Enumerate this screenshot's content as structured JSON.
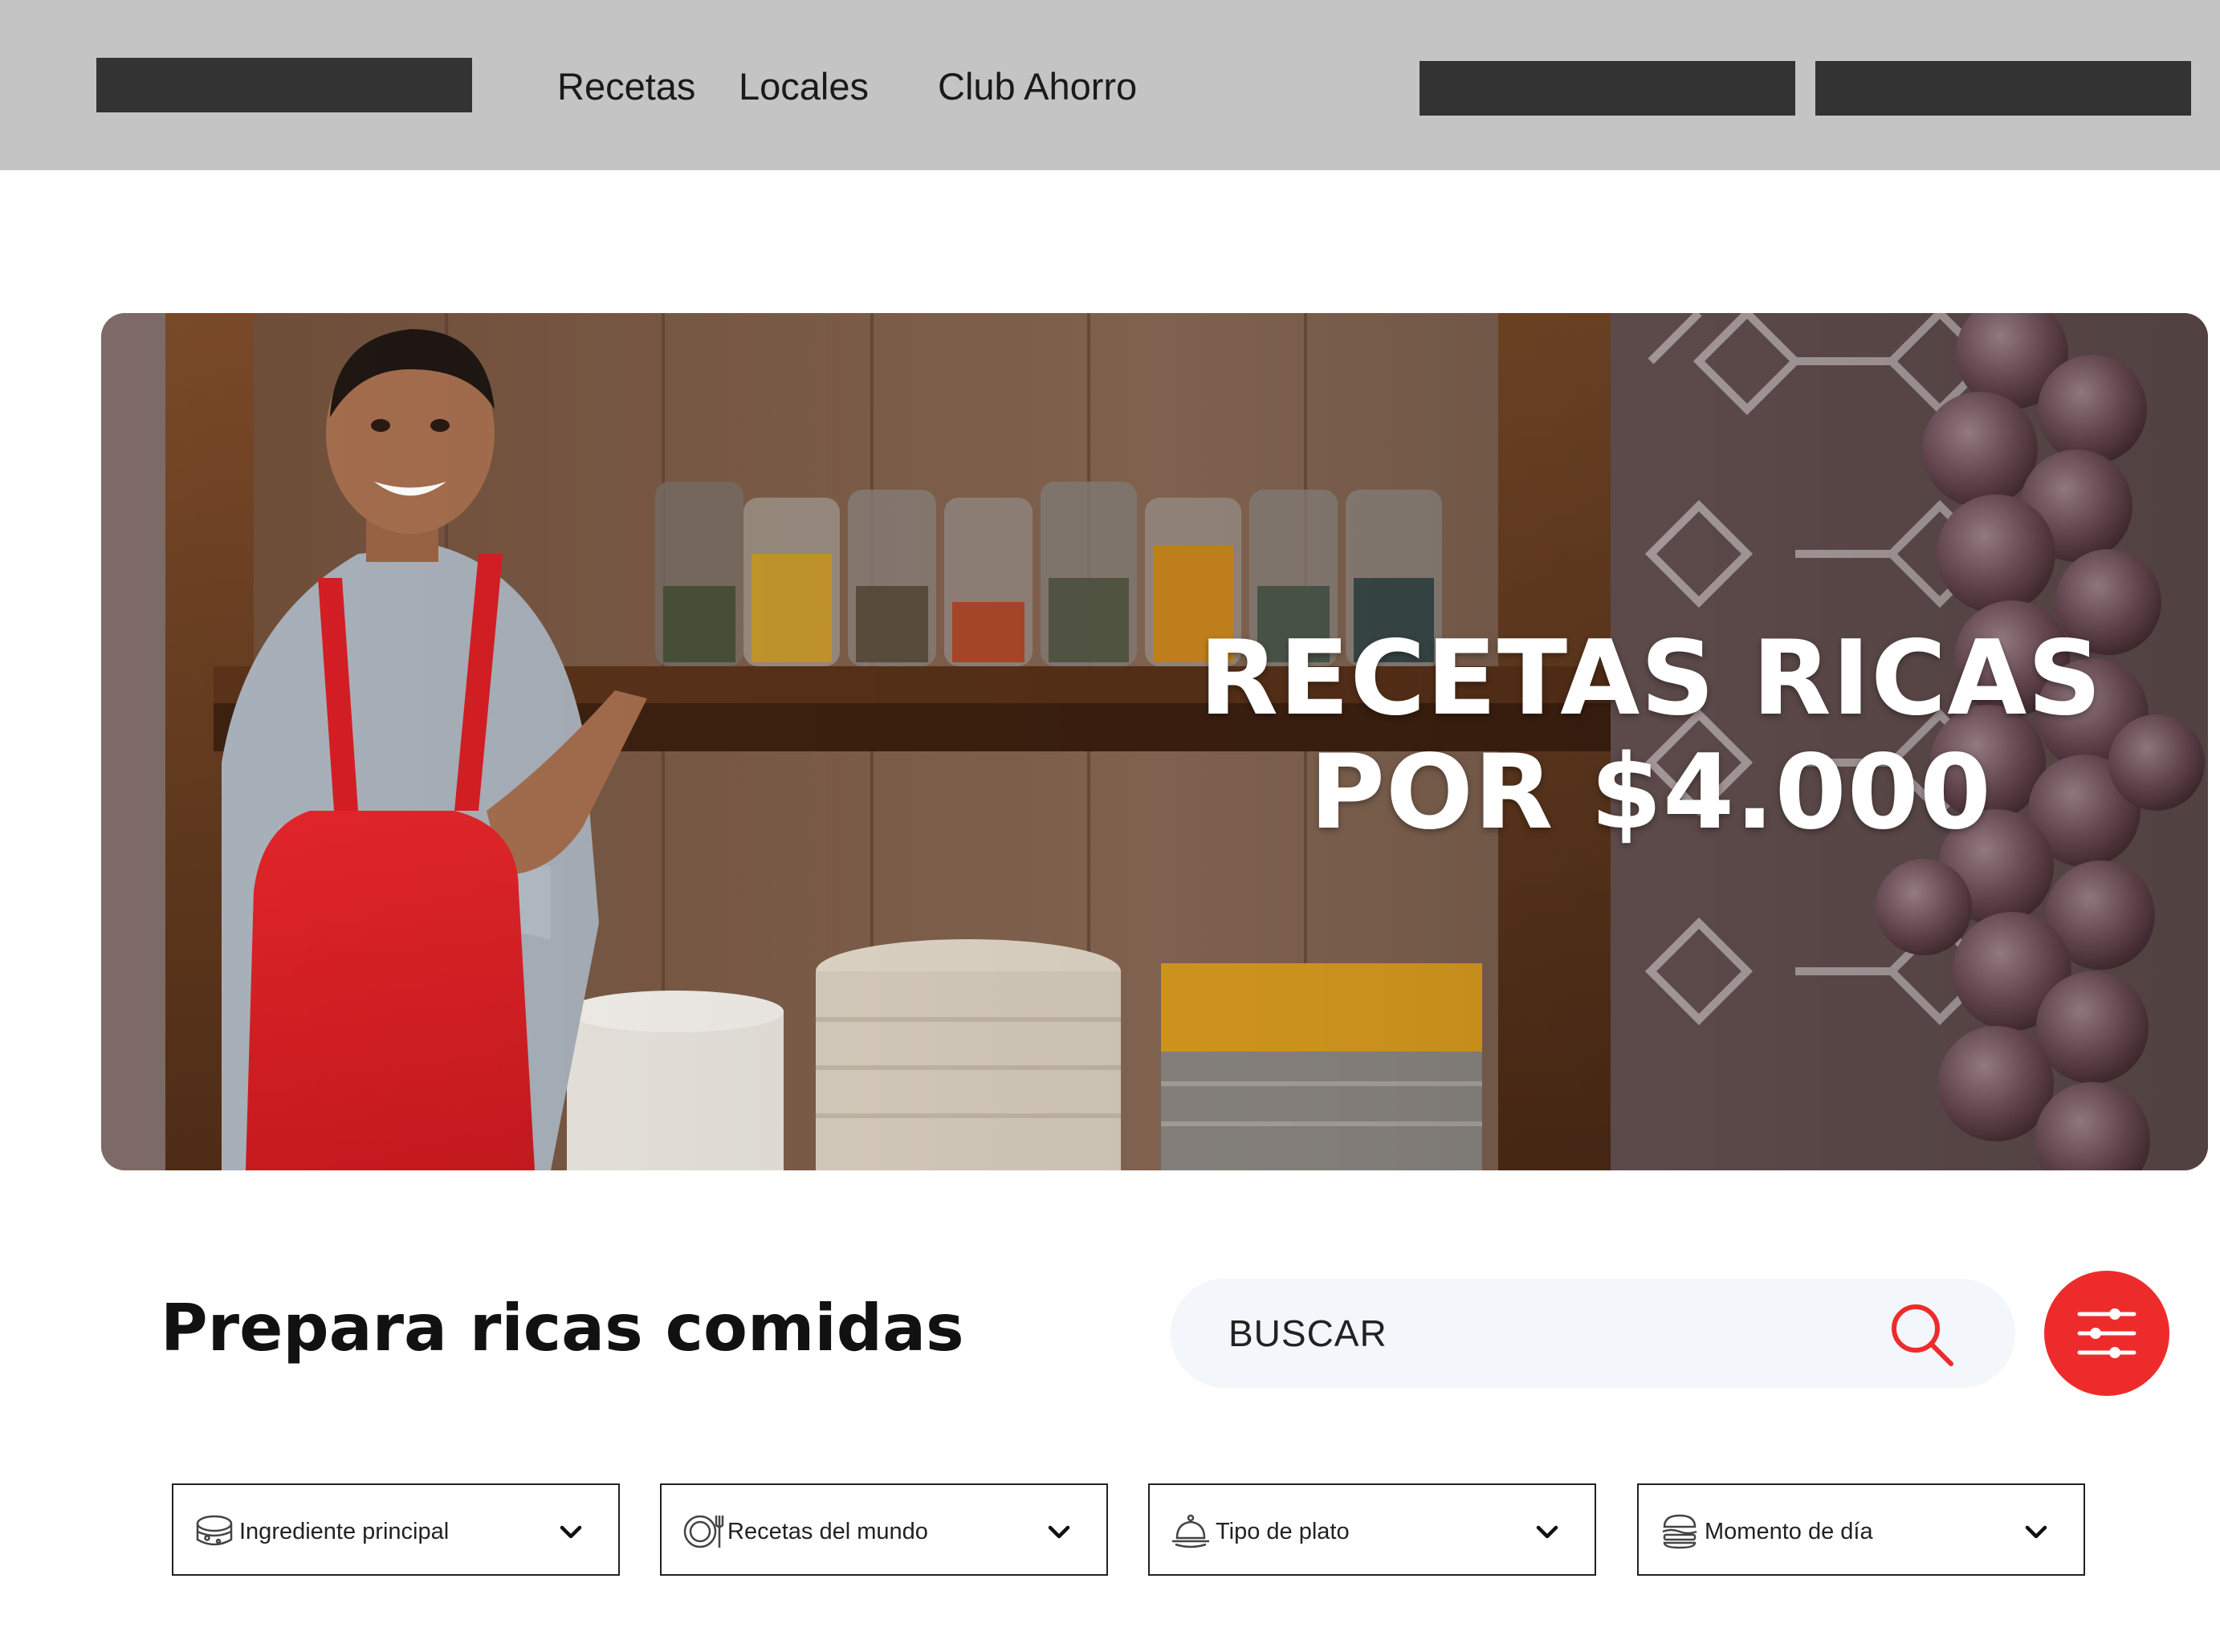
{
  "header": {
    "nav": [
      {
        "label": "Recetas"
      },
      {
        "label": "Locales"
      },
      {
        "label": "Club Ahorro"
      }
    ]
  },
  "hero": {
    "title_line1": "RECETAS RICAS",
    "title_line2": "POR $4.000"
  },
  "section": {
    "title": "Prepara ricas comidas"
  },
  "search": {
    "placeholder": "BUSCAR",
    "accent_color": "#ee2b2b"
  },
  "filters": [
    {
      "label": "Ingrediente principal",
      "icon": "cheese-icon"
    },
    {
      "label": "Recetas del mundo",
      "icon": "plate-icon"
    },
    {
      "label": "Tipo de plato",
      "icon": "dish-icon"
    },
    {
      "label": "Momento de día",
      "icon": "burger-icon"
    }
  ],
  "colors": {
    "header_bg": "#c4c4c4",
    "placeholder_blocks": "#333333",
    "search_bg": "#f3f6fb",
    "accent": "#ee2b2b"
  }
}
